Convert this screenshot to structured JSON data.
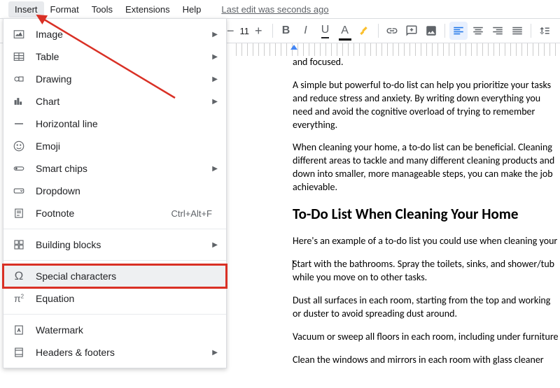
{
  "menubar": {
    "items": [
      "Insert",
      "Format",
      "Tools",
      "Extensions",
      "Help"
    ],
    "active_index": 0,
    "last_edit": "Last edit was seconds ago"
  },
  "toolbar": {
    "font_size": "11"
  },
  "dropdown": {
    "items": [
      {
        "label": "Image",
        "icon": "image",
        "submenu": true
      },
      {
        "label": "Table",
        "icon": "table",
        "submenu": true
      },
      {
        "label": "Drawing",
        "icon": "drawing",
        "submenu": true
      },
      {
        "label": "Chart",
        "icon": "chart",
        "submenu": true
      },
      {
        "label": "Horizontal line",
        "icon": "hline"
      },
      {
        "label": "Emoji",
        "icon": "emoji"
      },
      {
        "label": "Smart chips",
        "icon": "chips",
        "submenu": true
      },
      {
        "label": "Dropdown",
        "icon": "dropdownicon"
      },
      {
        "label": "Footnote",
        "icon": "footnote",
        "shortcut": "Ctrl+Alt+F"
      },
      {
        "divider": true
      },
      {
        "label": "Building blocks",
        "icon": "blocks",
        "submenu": true
      },
      {
        "divider": true
      },
      {
        "label": "Special characters",
        "icon": "omega",
        "highlighted": true
      },
      {
        "label": "Equation",
        "icon": "pi"
      },
      {
        "divider": true
      },
      {
        "label": "Watermark",
        "icon": "watermark"
      },
      {
        "label": "Headers & footers",
        "icon": "headers",
        "submenu": true
      }
    ]
  },
  "document": {
    "frag1": "and focused.",
    "para1": "A simple but powerful to-do list can help you prioritize your tasks and reduce stress and anxiety. By writing down everything you need and avoid the cognitive overload of trying to remember everything.",
    "para2": "When cleaning your home, a to-do list can be beneficial. Cleaning different areas to tackle and many different cleaning products and down into smaller, more manageable steps, you can make the job achievable.",
    "heading": "To-Do List When Cleaning Your Home",
    "para3": "Here's an example of a to-do list you could use when cleaning your",
    "para4": "Start with the bathrooms. Spray the toilets, sinks, and shower/tub while you move on to other tasks.",
    "para5": "Dust all surfaces in each room, starting from the top and working or duster to avoid spreading dust around.",
    "para6": "Vacuum or sweep all floors in each room, including under furniture",
    "para7": "Clean the windows and mirrors in each room with glass cleaner"
  }
}
